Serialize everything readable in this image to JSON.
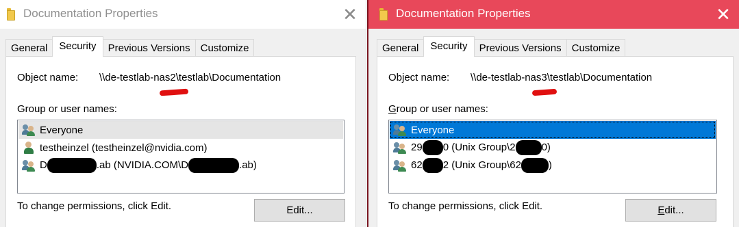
{
  "left_window": {
    "title": "Documentation Properties",
    "close_symbol": "✕",
    "icon": "folder-icon",
    "tabs": [
      {
        "label": "General"
      },
      {
        "label": "Security"
      },
      {
        "label": "Previous Versions"
      },
      {
        "label": "Customize"
      }
    ],
    "active_tab": "Security",
    "object_name_label": "Object name:",
    "object_name_value": "\\\\de-testlab-nas2\\testlab\\Documentation",
    "group_label": "Group or user names:",
    "entries": [
      {
        "text": "Everyone",
        "icon": "group-icon",
        "selected": true
      },
      {
        "text": "testheinzel (testheinzel@nvidia.com)",
        "icon": "user-icon"
      },
      {
        "text_parts": [
          "D",
          ".ab (NVIDIA.COM\\D",
          ".ab)"
        ],
        "icon": "group-icon"
      }
    ],
    "change_text": "To change permissions, click Edit.",
    "edit_label": "Edit..."
  },
  "right_window": {
    "title": "Documentation Properties",
    "close_symbol": "✕",
    "icon": "folder-icon",
    "tabs": [
      {
        "label": "General"
      },
      {
        "label": "Security"
      },
      {
        "label": "Previous Versions"
      },
      {
        "label": "Customize"
      }
    ],
    "active_tab": "Security",
    "object_name_label": "Object name:",
    "object_name_value": "\\\\de-testlab-nas3\\testlab\\Documentation",
    "group_label_prefix": "G",
    "group_label_rest": "roup or user names:",
    "entries": [
      {
        "text": "Everyone",
        "icon": "group-icon",
        "selected": true
      },
      {
        "text_parts": [
          "29",
          "0 (Unix Group\\2",
          "0)"
        ],
        "icon": "group-icon"
      },
      {
        "text_parts": [
          "62",
          "2 (Unix Group\\62",
          ")"
        ],
        "icon": "group-icon"
      }
    ],
    "change_text": "To change permissions, click Edit.",
    "edit_label_prefix": "E",
    "edit_label_rest": "dit..."
  },
  "colors": {
    "right_titlebar": "#e8485a",
    "selection_blue": "#0078d7",
    "redaction": "#000000",
    "highlight_mark": "#e01010"
  }
}
